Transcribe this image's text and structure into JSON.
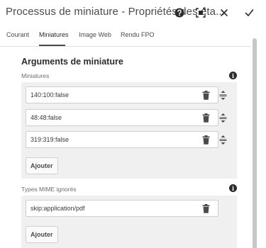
{
  "dialog": {
    "title": "Processus de miniature - Propriétés des éta..."
  },
  "tabs": [
    {
      "label": "Courant"
    },
    {
      "label": "Miniatures"
    },
    {
      "label": "Image Web"
    },
    {
      "label": "Rendu FPO"
    }
  ],
  "active_tab": "Miniatures",
  "section": {
    "title": "Arguments de miniature"
  },
  "thumbnails": {
    "label": "Miniatures",
    "info_glyph": "i",
    "items": [
      {
        "value": "140:100:false"
      },
      {
        "value": "48:48:false"
      },
      {
        "value": "319:319:false"
      }
    ],
    "add_label": "Ajouter"
  },
  "ignored_mime": {
    "label": "Types MIME ignorés",
    "info_glyph": "i",
    "items": [
      {
        "value": "skip:application/pdf"
      }
    ],
    "add_label": "Ajouter"
  },
  "icons": {
    "help": "help-icon",
    "fullscreen": "fullscreen-icon",
    "close": "close-icon",
    "confirm": "checkmark-icon",
    "delete": "trash-icon",
    "reorder": "drag-reorder-icon",
    "info": "info-icon"
  },
  "colors": {
    "panel_background": "#f0f0f0",
    "text_dark": "#2c2c2c",
    "label_gray": "#6e6e6e",
    "scrollbar": "#c7c7c7"
  }
}
